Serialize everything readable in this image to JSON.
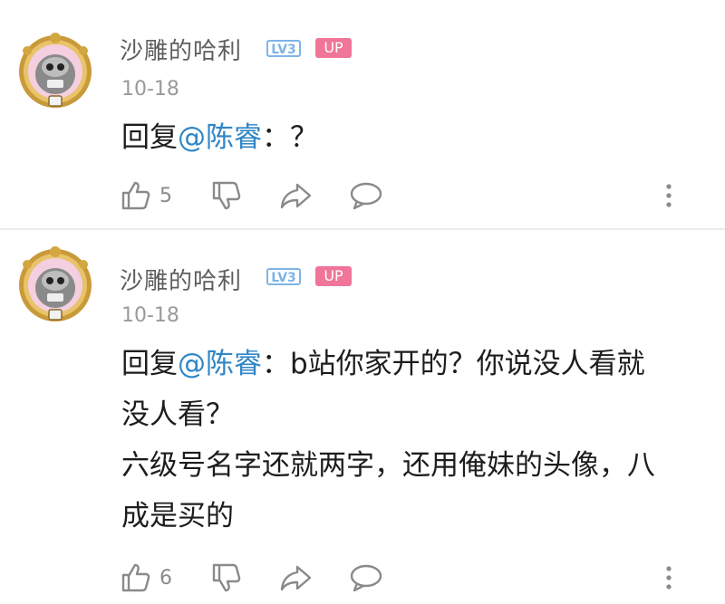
{
  "comments": [
    {
      "username": "沙雕的哈利",
      "level_badge": "LV3",
      "up_badge": "UP",
      "date": "10-18",
      "reply_prefix": "回复",
      "mention": "@陈睿",
      "text": "：？",
      "likes": "5",
      "avatar_icon": "avatar-icon"
    },
    {
      "username": "沙雕的哈利",
      "level_badge": "LV3",
      "up_badge": "UP",
      "date": "10-18",
      "reply_prefix": "回复",
      "mention": "@陈睿",
      "text_line1": "：b站你家开的？你说没人看就",
      "text_line2": "没人看？",
      "text_line3": "六级号名字还就两字，还用俺妹的头像，八",
      "text_line4": "成是买的",
      "likes": "6",
      "avatar_icon": "avatar-icon"
    }
  ],
  "colors": {
    "mention": "#2f86c6",
    "up_badge": "#f07599",
    "level_badge": "#7fb4e6",
    "username": "#5e5e5e",
    "meta": "#9a9a9a"
  },
  "icons": [
    "thumbs-up-icon",
    "thumbs-down-icon",
    "share-icon",
    "comment-icon",
    "more-icon"
  ]
}
